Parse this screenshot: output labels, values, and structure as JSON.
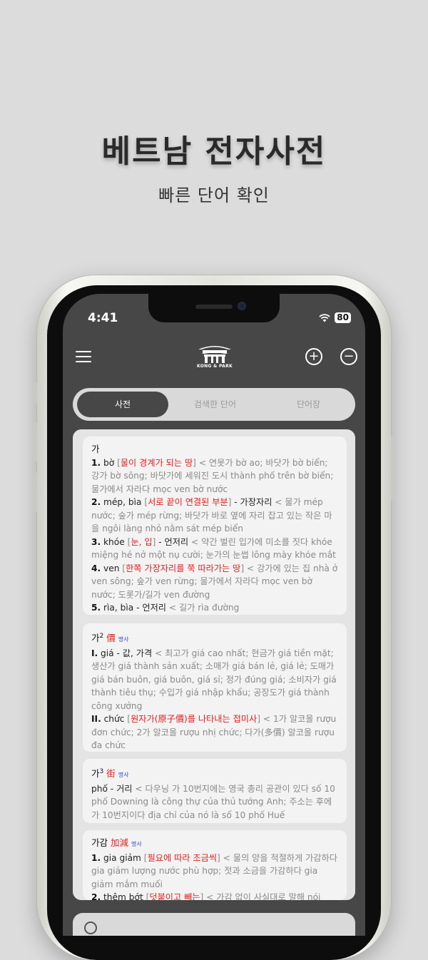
{
  "promo": {
    "title": "베트남 전자사전",
    "subtitle": "빠른 단어 확인"
  },
  "status_bar": {
    "time": "4:41",
    "battery": "80"
  },
  "app": {
    "logo_text": "KONG & PARK"
  },
  "tabs": [
    {
      "label": "사전"
    },
    {
      "label": "검색한 단어"
    },
    {
      "label": "단어장"
    }
  ],
  "entries": [
    {
      "headword": "가",
      "senses": [
        {
          "num": "1.",
          "word": "bờ",
          "note": "물이 경계가 되는 땅",
          "example": "< 연못가 bờ ao; 바닷가 bờ biển; 강가 bờ sông; 바닷가에 세워진 도시 thành phố trên bờ biển; 물가에서 자라다 mọc ven bờ nước"
        },
        {
          "num": "2.",
          "word": "mép, bìa",
          "note": "서로 끝이 연결된 부분",
          "meaning": "- 가장자리",
          "example": "< 물가 mép nước; 숲가 mép rừng; 바닷가 바로 옆에 자리 잡고 있는 작은 마을 ngôi làng nhỏ nằm sát mép biển"
        },
        {
          "num": "3.",
          "word": "khóe",
          "note": "눈, 입",
          "meaning": "- 언저리",
          "example": "< 약간 벌린 입가에 미소를 짓다 khóe miệng hé nở một nụ cười; 눈가의 눈썹 lông mày khóe mắt"
        },
        {
          "num": "4.",
          "word": "ven",
          "note": "한쪽 가장자리를 쭉 따라가는 땅",
          "example": "< 강가에 있는 집 nhà ở ven sông; 숲가 ven rừng; 물가에서 자라다 mọc ven bờ nước; 도롯가/길가 ven đường"
        },
        {
          "num": "5.",
          "word": "rìa, bìa",
          "meaning": "- 언저리",
          "example": "< 길가 rìa đường"
        }
      ]
    },
    {
      "headword": "가",
      "sup": "2",
      "hanja": "價",
      "pos": "명사",
      "senses": [
        {
          "num": "I.",
          "word": "giá",
          "meaning": "- 값, 가격",
          "example": "< 최고가 giá cao nhất; 현금가 giá tiền mặt; 생산가 giá thành sản xuất; 소매가 giá bán lẻ, giá lẻ; 도매가 giá bán buôn, giá buôn, giá sỉ; 정가 đúng giá; 소비자가 giá thành tiêu thụ; 수입가 giá nhập khẩu; 공장도가 giá thành công xưởng"
        },
        {
          "num": "II.",
          "word": "chức",
          "note": "원자가(原子價)를 나타내는 접미사",
          "example": "< 1가 알코올 rượu đơn chức; 2가 알코올 rượu nhị chức; 다가(多價) 알코올 rượu đa chức"
        }
      ]
    },
    {
      "headword": "가",
      "sup": "3",
      "hanja": "街",
      "pos": "명사",
      "senses": [
        {
          "num": "",
          "word": "phố",
          "meaning": "- 거리",
          "example": "< 다우닝 가 10번지에는 영국 총리 공관이 있다 số 10 phố Downing là công thự của thủ tướng Anh; 주소는 후에 가 10번지이다 địa chỉ của nó là số 10 phố Huế"
        }
      ]
    },
    {
      "headword": "가감",
      "hanja": "加減",
      "pos": "명사",
      "senses": [
        {
          "num": "1.",
          "word": "gia giảm",
          "note": "필요에 따라 조금씩",
          "example": "< 물의 양을 적절하게 가감하다 gia giảm lượng nước phù hợp; 젓과 소금을 가감하다 gia giảm mắm muối"
        },
        {
          "num": "2.",
          "word": "thêm bớt",
          "note": "덧붙이고 빼는",
          "example": "< 가감 없이 사실대로 말해 nói"
        }
      ]
    }
  ]
}
